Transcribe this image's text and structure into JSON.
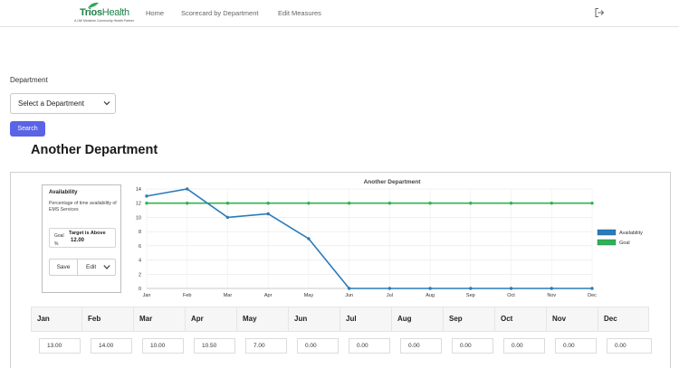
{
  "header": {
    "logo_brand": "Trios",
    "logo_health": "Health",
    "logo_tagline": "A UW Medicine Community Health Partner",
    "nav": [
      "Home",
      "Scorecard by Department",
      "Edit Measures"
    ],
    "logout_icon": "logout-icon"
  },
  "filter": {
    "department_label": "Department",
    "department_select_value": "Select a Department",
    "search_label": "Search"
  },
  "department_title": "Another Department",
  "measure": {
    "title": "Availability",
    "description": "Percentage of time availability of EMS Services",
    "goal_label": "Goal %",
    "goal_target": "Target is Above",
    "goal_value": "12.00",
    "save_label": "Save",
    "edit_label": "Edit"
  },
  "chart_data": {
    "type": "line",
    "title": "Another Department",
    "categories": [
      "Jan",
      "Feb",
      "Mar",
      "Apr",
      "May",
      "Jun",
      "Jul",
      "Aug",
      "Sep",
      "Oct",
      "Nov",
      "Dec"
    ],
    "series": [
      {
        "name": "Availability",
        "color": "#2b7bb9",
        "values": [
          13,
          14,
          10,
          10.5,
          7,
          0,
          0,
          0,
          0,
          0,
          0,
          0
        ]
      },
      {
        "name": "Goal",
        "color": "#2fb34e",
        "values": [
          12,
          12,
          12,
          12,
          12,
          12,
          12,
          12,
          12,
          12,
          12,
          12
        ]
      }
    ],
    "yticks": [
      0,
      2,
      4,
      6,
      8,
      10,
      12,
      14
    ],
    "ylim": [
      0,
      14
    ],
    "grid": true,
    "legend": "right"
  },
  "months_table": {
    "headers": [
      "Jan",
      "Feb",
      "Mar",
      "Apr",
      "May",
      "Jun",
      "Jul",
      "Aug",
      "Sep",
      "Oct",
      "Nov",
      "Dec"
    ],
    "values": [
      "13.00",
      "14.00",
      "10.00",
      "10.50",
      "7.00",
      "0.00",
      "0.00",
      "0.00",
      "0.00",
      "0.00",
      "0.00",
      "0.00"
    ]
  }
}
